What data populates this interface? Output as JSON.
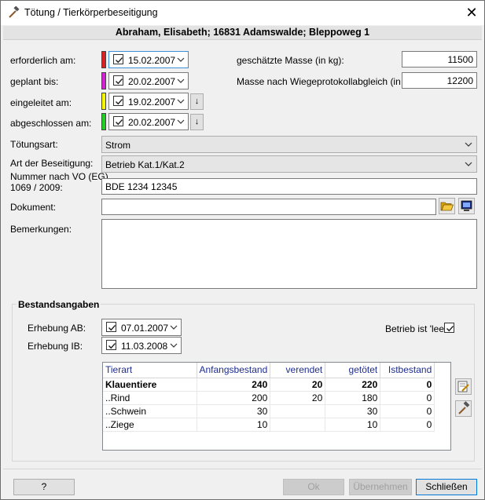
{
  "window": {
    "title": "Tötung / Tierkörperbeseitigung",
    "close_symbol": "✕"
  },
  "subject": "Abraham, Elisabeth; 16831 Adamswalde; Bleppoweg 1",
  "dates": [
    {
      "label": "erforderlich am:",
      "value": "15.02.2007",
      "color": "#e02020",
      "checked": true
    },
    {
      "label": "geplant bis:",
      "value": "20.02.2007",
      "color": "#d81ed8",
      "checked": true
    },
    {
      "label": "eingeleitet am:",
      "value": "19.02.2007",
      "color": "#f5f500",
      "checked": true
    },
    {
      "label": "abgeschlossen am:",
      "value": "20.02.2007",
      "color": "#22d022",
      "checked": true
    }
  ],
  "down_arrow": "↓",
  "masse": {
    "geschaetzt_label": "geschätzte Masse (in kg):",
    "geschaetzt_value": "11500",
    "wiege_label": "Masse nach Wiegeprotokollabgleich (in kg):",
    "wiege_value": "12200"
  },
  "toetungsart": {
    "label": "Tötungsart:",
    "value": "Strom"
  },
  "beseitigung": {
    "label": "Art der Beseitigung:",
    "value": "Betrieb Kat.1/Kat.2"
  },
  "nummer": {
    "label_line1": "Nummer nach VO (EG)",
    "label_line2": "1069 / 2009:",
    "value": "BDE 1234 12345"
  },
  "dokument": {
    "label": "Dokument:",
    "value": ""
  },
  "bemerkungen": {
    "label": "Bemerkungen:",
    "value": ""
  },
  "bestand": {
    "title": "Bestandsangaben",
    "erhebung_ab_label": "Erhebung AB:",
    "erhebung_ab_value": "07.01.2007",
    "erhebung_ib_label": "Erhebung IB:",
    "erhebung_ib_value": "11.03.2008",
    "leer_label": "Betrieb ist 'leer'",
    "leer_checked": true,
    "columns": [
      "Tierart",
      "Anfangsbestand",
      "verendet",
      "getötet",
      "Istbestand"
    ],
    "rows": [
      {
        "tierart": "Klauentiere",
        "anfang": "240",
        "verendet": "20",
        "getoetet": "220",
        "ist": "0",
        "bold": true
      },
      {
        "tierart": "..Rind",
        "anfang": "200",
        "verendet": "20",
        "getoetet": "180",
        "ist": "0",
        "bold": false
      },
      {
        "tierart": "..Schwein",
        "anfang": "30",
        "verendet": "",
        "getoetet": "30",
        "ist": "0",
        "bold": false
      },
      {
        "tierart": "..Ziege",
        "anfang": "10",
        "verendet": "",
        "getoetet": "10",
        "ist": "0",
        "bold": false
      }
    ]
  },
  "buttons": {
    "help": "?",
    "ok": "Ok",
    "apply": "Übernehmen",
    "close": "Schließen"
  },
  "icons": {
    "title": "hammer-icon",
    "browse": "folder-open-icon",
    "view": "monitor-icon",
    "edit": "edit-note-icon",
    "tool": "hammer-icon"
  }
}
